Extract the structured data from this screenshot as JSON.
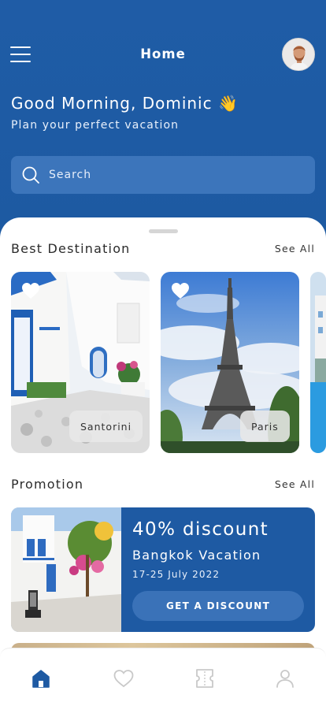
{
  "header": {
    "title": "Home",
    "greeting": "Good Morning, Dominic 👋",
    "subtitle": "Plan your perfect vacation"
  },
  "search": {
    "placeholder": "Search",
    "value": ""
  },
  "best_destination": {
    "title": "Best Destination",
    "see_all": "See All",
    "items": [
      {
        "name": "Santorini"
      },
      {
        "name": "Paris"
      }
    ]
  },
  "promotion": {
    "title": "Promotion",
    "see_all": "See All",
    "items": [
      {
        "discount": "40% discount",
        "name": "Bangkok Vacation",
        "dates": "17-25 July 2022",
        "button": "GET A DISCOUNT"
      }
    ]
  },
  "tabbar": {
    "items": [
      "home-icon",
      "heart-icon",
      "ticket-icon",
      "profile-icon"
    ],
    "active": "home-icon"
  },
  "colors": {
    "primary": "#1e5aa3",
    "accent": "#3a72b8",
    "inactive_icon": "#c9c9c9"
  }
}
